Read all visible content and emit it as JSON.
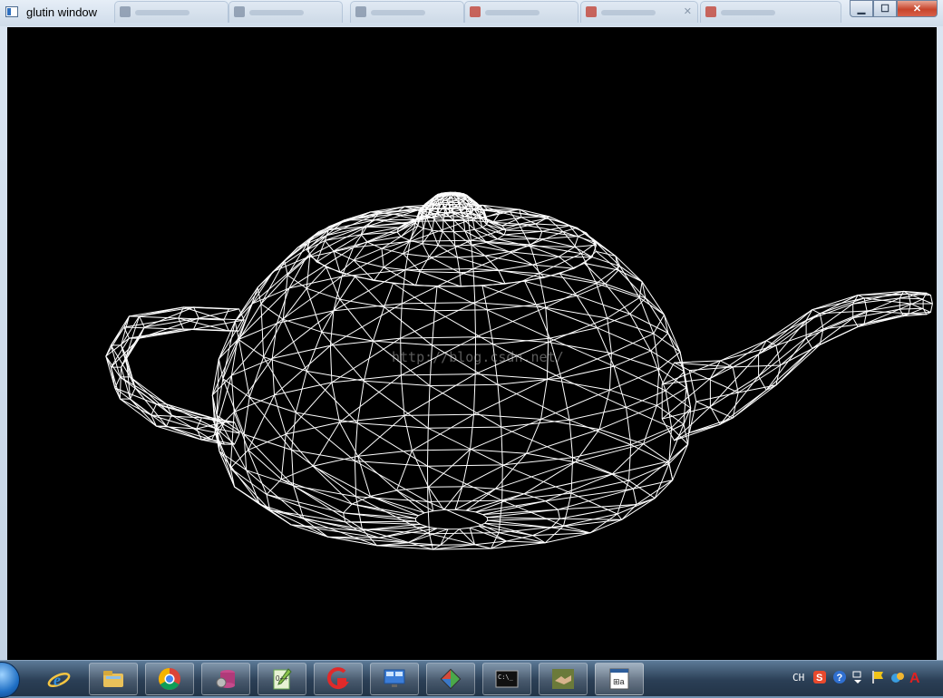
{
  "window": {
    "title": "glutin window",
    "controls": {
      "minimize": "▁",
      "maximize": "☐",
      "close": "✕"
    }
  },
  "background_tabs": [
    {
      "fav_color": "#7d8da3"
    },
    {
      "fav_color": "#7d8da3"
    },
    {
      "fav_color": "#7d8da3"
    },
    {
      "fav_color": "#c0392b"
    },
    {
      "fav_color": "#c0392b"
    },
    {
      "fav_color": "#c0392b"
    }
  ],
  "scene": {
    "watermark": "http://blog.csdn.net/",
    "background_color": "#000000",
    "wireframe_color": "#ffffff"
  },
  "taskbar": {
    "apps": [
      {
        "icon": "internet-explorer-icon"
      },
      {
        "icon": "file-explorer-icon"
      },
      {
        "icon": "chrome-icon"
      },
      {
        "icon": "database-icon"
      },
      {
        "icon": "notepad-plus-plus-icon"
      },
      {
        "icon": "red-app-icon"
      },
      {
        "icon": "remote-desktop-icon"
      },
      {
        "icon": "git-icon"
      },
      {
        "icon": "console-icon"
      },
      {
        "icon": "handshake-icon"
      },
      {
        "icon": "app-window-icon"
      }
    ],
    "tray": {
      "language": "CH",
      "icons": [
        "sogou-icon",
        "help-icon",
        "tray-expand-icon",
        "flag-icon",
        "network-icon",
        "adobe-icon"
      ]
    }
  }
}
